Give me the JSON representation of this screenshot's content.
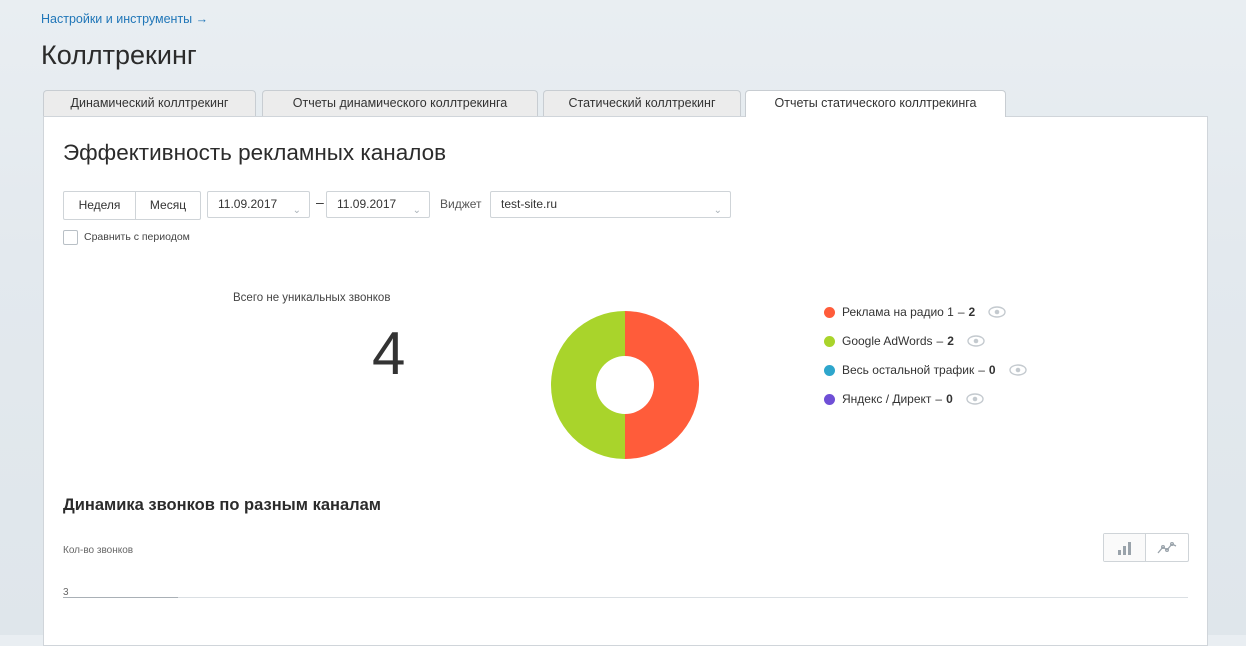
{
  "breadcrumb": "Настройки и инструменты →",
  "title": "Коллтрекинг",
  "tabs": [
    {
      "label": "Динамический коллтрекинг"
    },
    {
      "label": "Отчеты динамического коллтрекинга"
    },
    {
      "label": "Статический коллтрекинг"
    },
    {
      "label": "Отчеты статического коллтрекинга",
      "active": true
    }
  ],
  "report": {
    "title": "Эффективность рекламных каналов",
    "period_buttons": {
      "week": "Неделя",
      "month": "Месяц"
    },
    "date_from": "11.09.2017",
    "date_to": "11.09.2017",
    "range_separator": "–",
    "widget_label": "Виджет",
    "widget_value": "test-site.ru",
    "compare_label": "Сравнить с периодом",
    "compare_checked": false
  },
  "metric": {
    "label": "Всего не уникальных звонков",
    "value": "4"
  },
  "legend": [
    {
      "label": "Реклама на радио 1",
      "value": "2",
      "color": "#ff5c3a",
      "icon": "eye-icon"
    },
    {
      "label": "Google AdWords",
      "value": "2",
      "color": "#a9d42b",
      "icon": "eye-icon"
    },
    {
      "label": "Весь остальной трафик",
      "value": "0",
      "color": "#2ea6cc",
      "icon": "eye-icon"
    },
    {
      "label": "Яндекс / Директ",
      "value": "0",
      "color": "#6f4fd6",
      "icon": "eye-icon"
    }
  ],
  "legend_separator": "–",
  "chart_data": [
    {
      "type": "pie",
      "donut": true,
      "categories": [
        "Реклама на радио 1",
        "Google AdWords",
        "Весь остальной трафик",
        "Яндекс / Директ"
      ],
      "values": [
        2,
        2,
        0,
        0
      ],
      "colors": [
        "#ff5c3a",
        "#a9d42b",
        "#2ea6cc",
        "#6f4fd6"
      ],
      "legend": "right"
    },
    {
      "type": "line",
      "title": "Динамика звонков по разным каналам",
      "ylabel": "Кол-во звонков",
      "yticks": [
        "3"
      ],
      "grid": true
    }
  ],
  "dynamics": {
    "title": "Динамика звонков по разным каналам",
    "axis_caption": "Кол-во звонков",
    "tick": "3",
    "toggle": [
      {
        "icon": "bar-chart-icon"
      },
      {
        "icon": "line-chart-icon"
      }
    ]
  },
  "colors": {
    "accent": "#1f76b8"
  }
}
